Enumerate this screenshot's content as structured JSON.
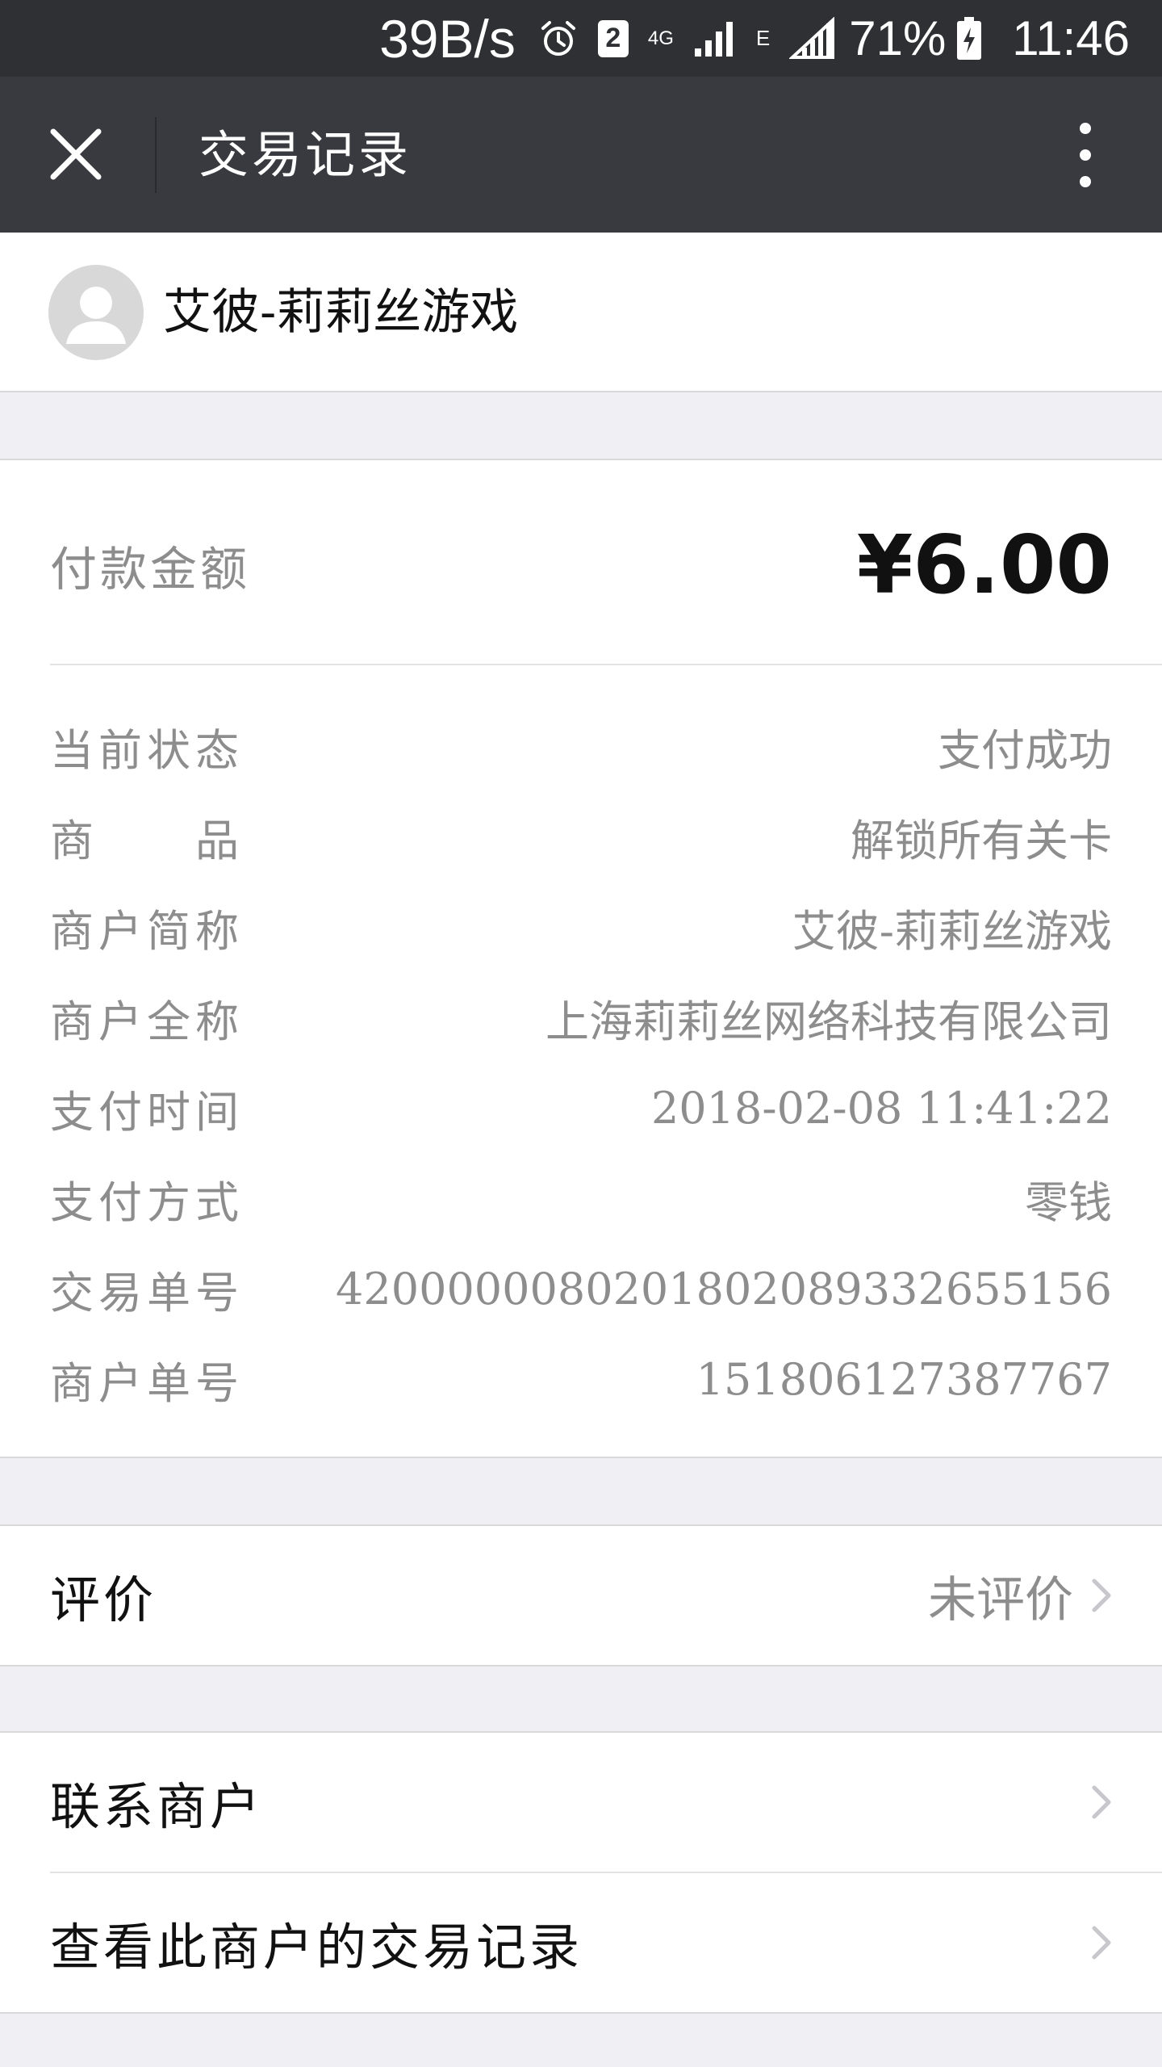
{
  "status_bar": {
    "speed": "39B/s",
    "icons": [
      "alarm-icon",
      "sim-2-icon",
      "network-4g-icon",
      "signal-icon",
      "e-network-icon",
      "signal-full-icon",
      "battery-charging-icon"
    ],
    "sim_label": "2",
    "net_label": "4G",
    "e_label": "E",
    "battery": "71%",
    "time": "11:46"
  },
  "nav": {
    "title": "交易记录",
    "close_icon": "close-icon",
    "more_icon": "more-vertical-icon"
  },
  "merchant": {
    "avatar_icon": "user-avatar-icon",
    "name": "艾彼-莉莉丝游戏"
  },
  "payment": {
    "amount_label": "付款金额",
    "amount": "¥6.00"
  },
  "details": [
    {
      "label": "当前状态",
      "value": "支付成功"
    },
    {
      "label": "商　　品",
      "value": "解锁所有关卡"
    },
    {
      "label": "商户简称",
      "value": "艾彼-莉莉丝游戏"
    },
    {
      "label": "商户全称",
      "value": "上海莉莉丝网络科技有限公司"
    },
    {
      "label": "支付时间",
      "value": "2018-02-08 11:41:22"
    },
    {
      "label": "支付方式",
      "value": "零钱"
    },
    {
      "label": "交易单号",
      "value": "4200000080201802089332655156"
    },
    {
      "label": "商户单号",
      "value": "151806127387767"
    }
  ],
  "review": {
    "title": "评价",
    "value": "未评价"
  },
  "actions": {
    "contact": "联系商户",
    "history": "查看此商户的交易记录"
  },
  "colors": {
    "status_bar": "#2f3033",
    "nav_bar": "#393a3f",
    "page_bg": "#efeff4",
    "card_bg": "#ffffff",
    "muted_text": "#8d8d8d",
    "primary_text": "#111111"
  }
}
